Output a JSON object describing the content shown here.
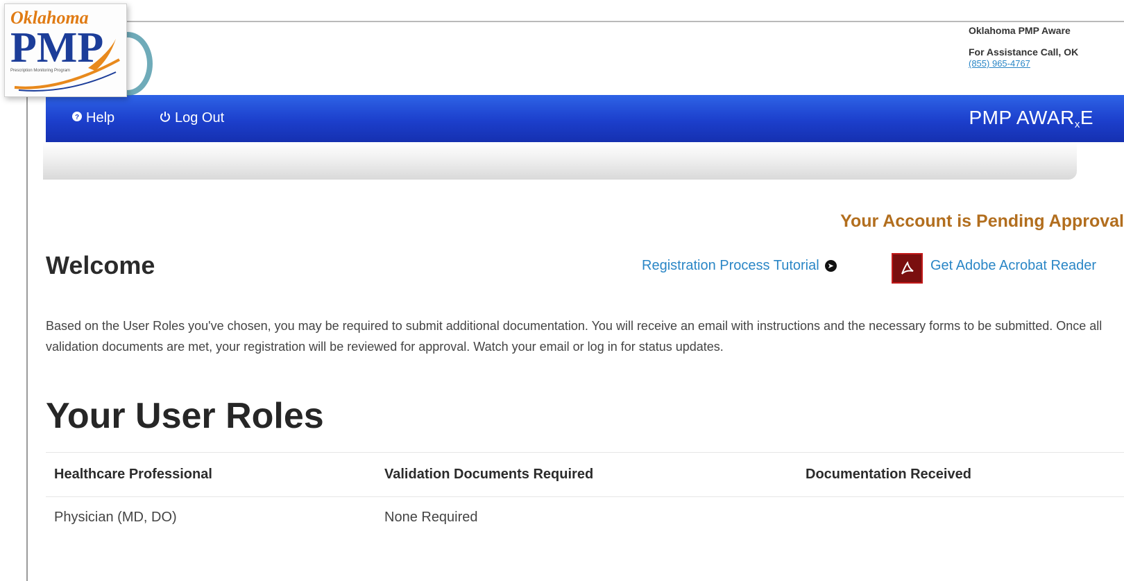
{
  "logo": {
    "top_text": "Oklahoma",
    "main_text": "PMP",
    "tagline": "Prescription Monitoring Program"
  },
  "header": {
    "site_name": "Oklahoma PMP Aware",
    "assistance_label": "For Assistance Call, OK",
    "phone": "(855) 965-4767"
  },
  "nav": {
    "help": "Help",
    "logout": "Log Out",
    "brand_main": "PMP AWAR",
    "brand_sub": "x",
    "brand_end": "E"
  },
  "status": {
    "pending": "Your Account is Pending Approval"
  },
  "welcome": {
    "title": "Welcome",
    "tutorial_link": "Registration Process Tutorial",
    "adobe_link": "Get Adobe Acrobat Reader",
    "paragraph": "Based on the User Roles you've chosen, you may be required to submit additional documentation. You will receive an email with instructions and the necessary forms to be submitted. Once all validation documents are met, your registration will be reviewed for approval. Watch your email or log in for status updates."
  },
  "roles": {
    "title": "Your User Roles",
    "columns": [
      "Healthcare Professional",
      "Validation Documents Required",
      "Documentation Received"
    ],
    "rows": [
      [
        "Physician (MD, DO)",
        "None Required",
        ""
      ]
    ]
  },
  "colors": {
    "nav_blue": "#1c3fcc",
    "pending_text": "#b26e1e",
    "link_blue": "#2a86c6",
    "logo_blue": "#1c3d99",
    "logo_orange": "#e8891c"
  }
}
